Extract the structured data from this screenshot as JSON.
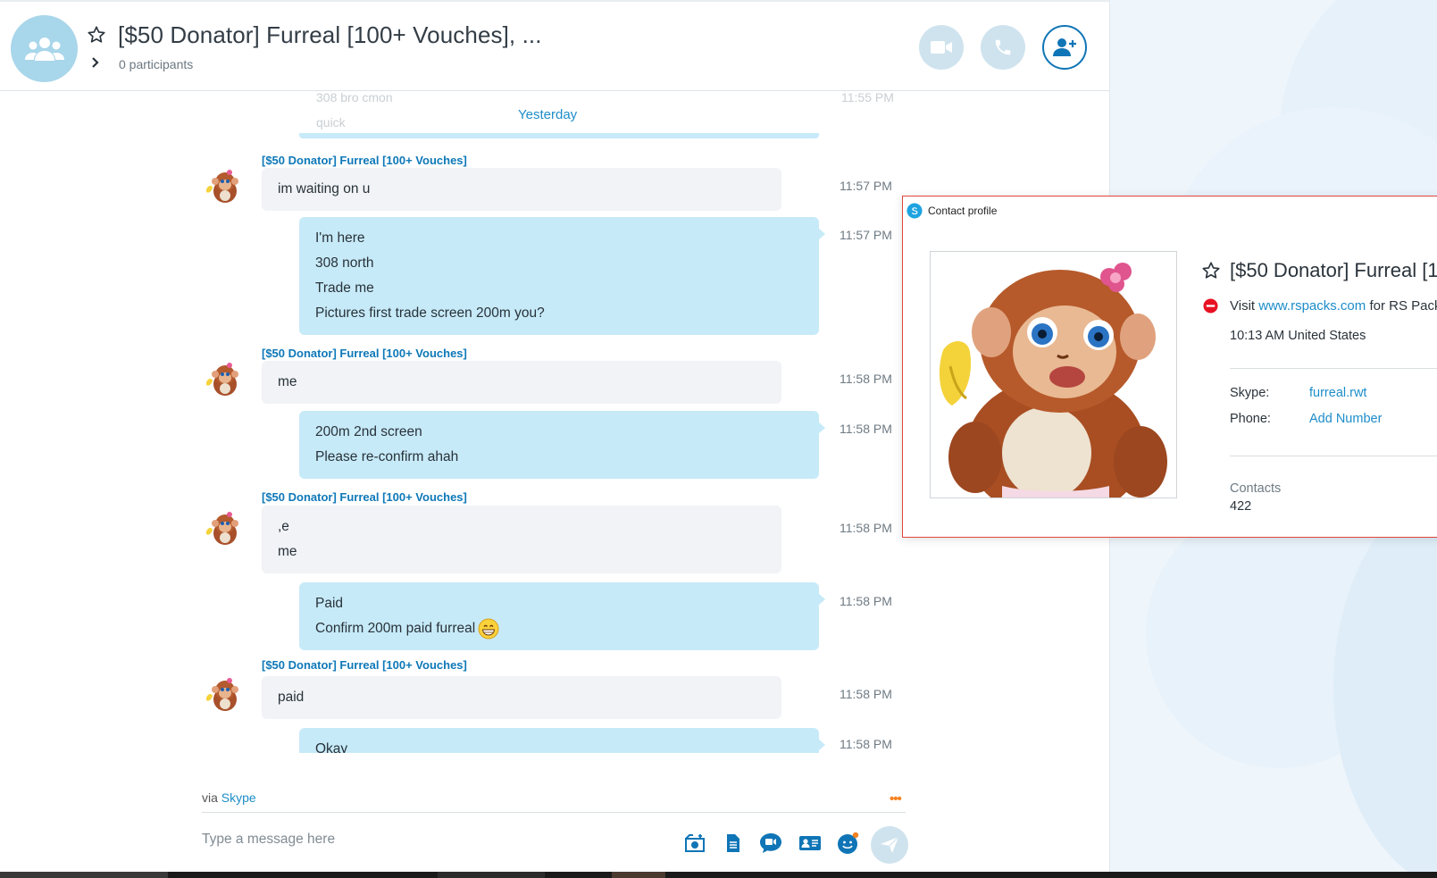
{
  "header": {
    "title": "[$50 Donator] Furreal [100+ Vouches], ...",
    "participants": "0 participants"
  },
  "chat": {
    "faded_lines": [
      "308 bro cmon",
      "quick"
    ],
    "faded_time": "11:55 PM",
    "day_label": "Yesterday",
    "sender_name": "[$50 Donator] Furreal [100+ Vouches]",
    "messages": [
      {
        "dir": "in",
        "lines": [
          "im waiting on u"
        ],
        "time": "11:57 PM"
      },
      {
        "dir": "out",
        "lines": [
          "I'm here",
          "308 north",
          "Trade me",
          "Pictures first trade screen 200m you?"
        ],
        "time": "11:57 PM"
      },
      {
        "dir": "in",
        "lines": [
          "me"
        ],
        "time": "11:58 PM"
      },
      {
        "dir": "out",
        "lines": [
          "200m 2nd screen",
          "Please re-confirm ahah"
        ],
        "time": "11:58 PM"
      },
      {
        "dir": "in",
        "lines": [
          ",e",
          "me"
        ],
        "time": "11:58 PM"
      },
      {
        "dir": "out",
        "lines": [
          "Paid",
          "Confirm 200m paid furreal"
        ],
        "time": "11:58 PM",
        "emoji": "grin-icon"
      },
      {
        "dir": "in",
        "lines": [
          "paid"
        ],
        "time": "11:58 PM"
      },
      {
        "dir": "out",
        "lines": [
          "Okay"
        ],
        "time": "11:58 PM"
      }
    ]
  },
  "footer": {
    "via_prefix": "via",
    "via_link": "Skype",
    "more": "•••",
    "placeholder": "Type a message here",
    "tools": [
      "send-media-icon",
      "send-file-icon",
      "video-message-icon",
      "contact-card-icon",
      "emoticon-icon"
    ]
  },
  "profile": {
    "window_title": "Contact profile",
    "name": "[$50 Donator] Furreal [1",
    "mood_prefix": "Visit",
    "mood_link": "www.rspacks.com",
    "mood_suffix": "for RS Pack C",
    "local_time": "10:13 AM United States",
    "skype_label": "Skype:",
    "skype_value": "furreal.rwt",
    "phone_label": "Phone:",
    "phone_value": "Add Number",
    "contacts_label": "Contacts",
    "contacts_value": "422"
  },
  "colors": {
    "accent": "#1d8dc9",
    "outgoing_bubble": "#c7eaf8",
    "incoming_bubble": "#f1f3f6",
    "status_dnd": "#e81123"
  }
}
